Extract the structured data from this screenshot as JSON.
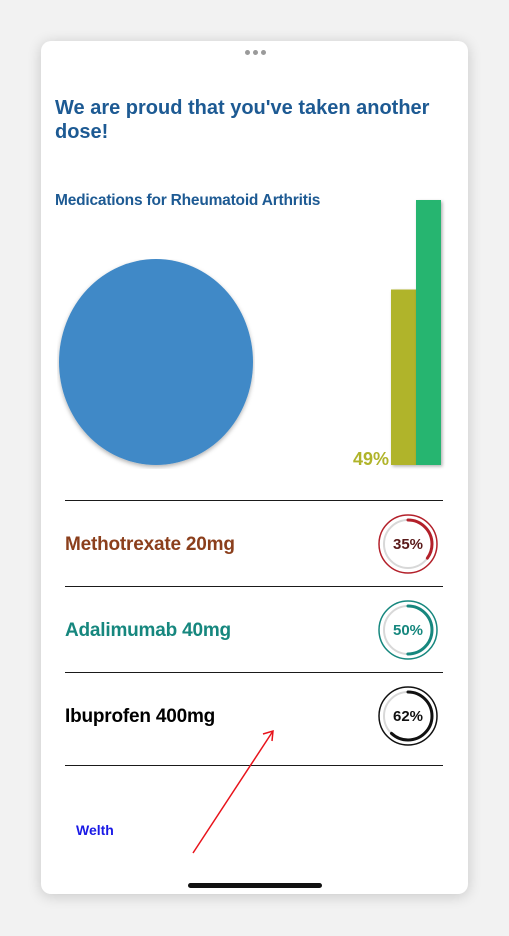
{
  "headline": "We are proud that you've taken another dose!",
  "section_title": "Medications for Rheumatoid Arthritis",
  "colors": {
    "title_blue": "#1d5a93",
    "pie_blue": "#4189c7",
    "bar_olive": "#b0b42a",
    "bar_green": "#25b56f"
  },
  "chart_data": [
    {
      "type": "pie",
      "values": [
        100
      ],
      "colors": [
        "#4189c7"
      ]
    },
    {
      "type": "bar",
      "values": [
        49,
        74
      ],
      "colors": [
        "#b0b42a",
        "#25b56f"
      ],
      "data_labels": [
        "49%",
        ""
      ]
    }
  ],
  "medications": [
    {
      "name": "Methotrexate 20mg",
      "percent": 35,
      "percent_label": "35%",
      "color": "#8b3f1c",
      "ring_color": "#b3202a",
      "text_color": "#5a1a1a"
    },
    {
      "name": "Adalimumab 40mg",
      "percent": 50,
      "percent_label": "50%",
      "color": "#16877e",
      "ring_color": "#16877e",
      "text_color": "#16877e"
    },
    {
      "name": "Ibuprofen 400mg",
      "percent": 62,
      "percent_label": "62%",
      "color": "#000000",
      "ring_color": "#111111",
      "text_color": "#111111"
    }
  ],
  "brand": "Welth"
}
